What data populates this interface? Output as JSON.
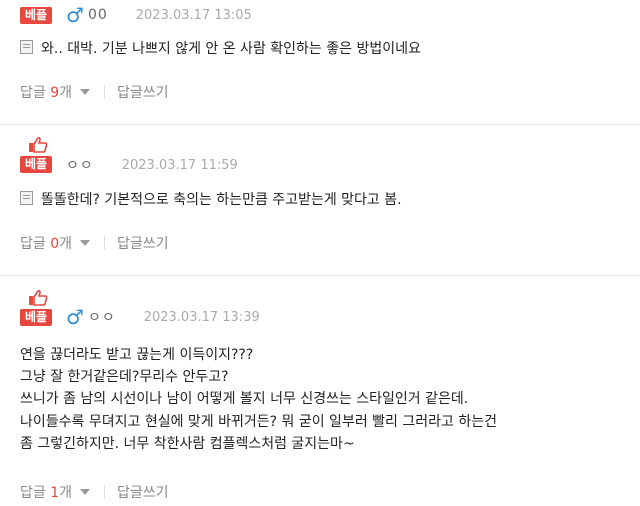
{
  "badge_label": "베플",
  "comments": [
    {
      "name": "00",
      "date": "2023.03.17 13:05",
      "lines": [
        "와.. 대박. 기분 나쁘지 않게 안 온 사람 확인하는 좋은 방법이네요"
      ],
      "reply_label": "답글",
      "reply_count": "9",
      "count_unit": "개",
      "write_label": "답글쓰기"
    },
    {
      "name": "ㅇㅇ",
      "date": "2023.03.17 11:59",
      "lines": [
        "똘똘한데? 기본적으로 축의는 하는만큼 주고받는게 맞다고 봄."
      ],
      "reply_label": "답글",
      "reply_count": "0",
      "count_unit": "개",
      "write_label": "답글쓰기"
    },
    {
      "name": "ㅇㅇ",
      "date": "2023.03.17 13:39",
      "lines": [
        "연을 끊더라도 받고 끊는게 이득이지???",
        "그냥 잘 한거같은데?무리수 안두고?",
        "쓰니가 좀 남의 시선이나 남이 어떻게 볼지 너무 신경쓰는 스타일인거 같은데.",
        "나이들수록 무뎌지고 현실에 맞게 바뀌거든? 뭐 굳이 일부러 빨리 그러라고 하는건",
        "좀 그렇긴하지만. 너무 착한사람 컴플렉스처럼 굴지는마~"
      ],
      "reply_label": "답글",
      "reply_count": "1",
      "count_unit": "개",
      "write_label": "답글쓰기"
    }
  ],
  "colors": {
    "badge": "#e8473f",
    "male_icon": "#2d8ed8",
    "count": "#e8473f"
  }
}
